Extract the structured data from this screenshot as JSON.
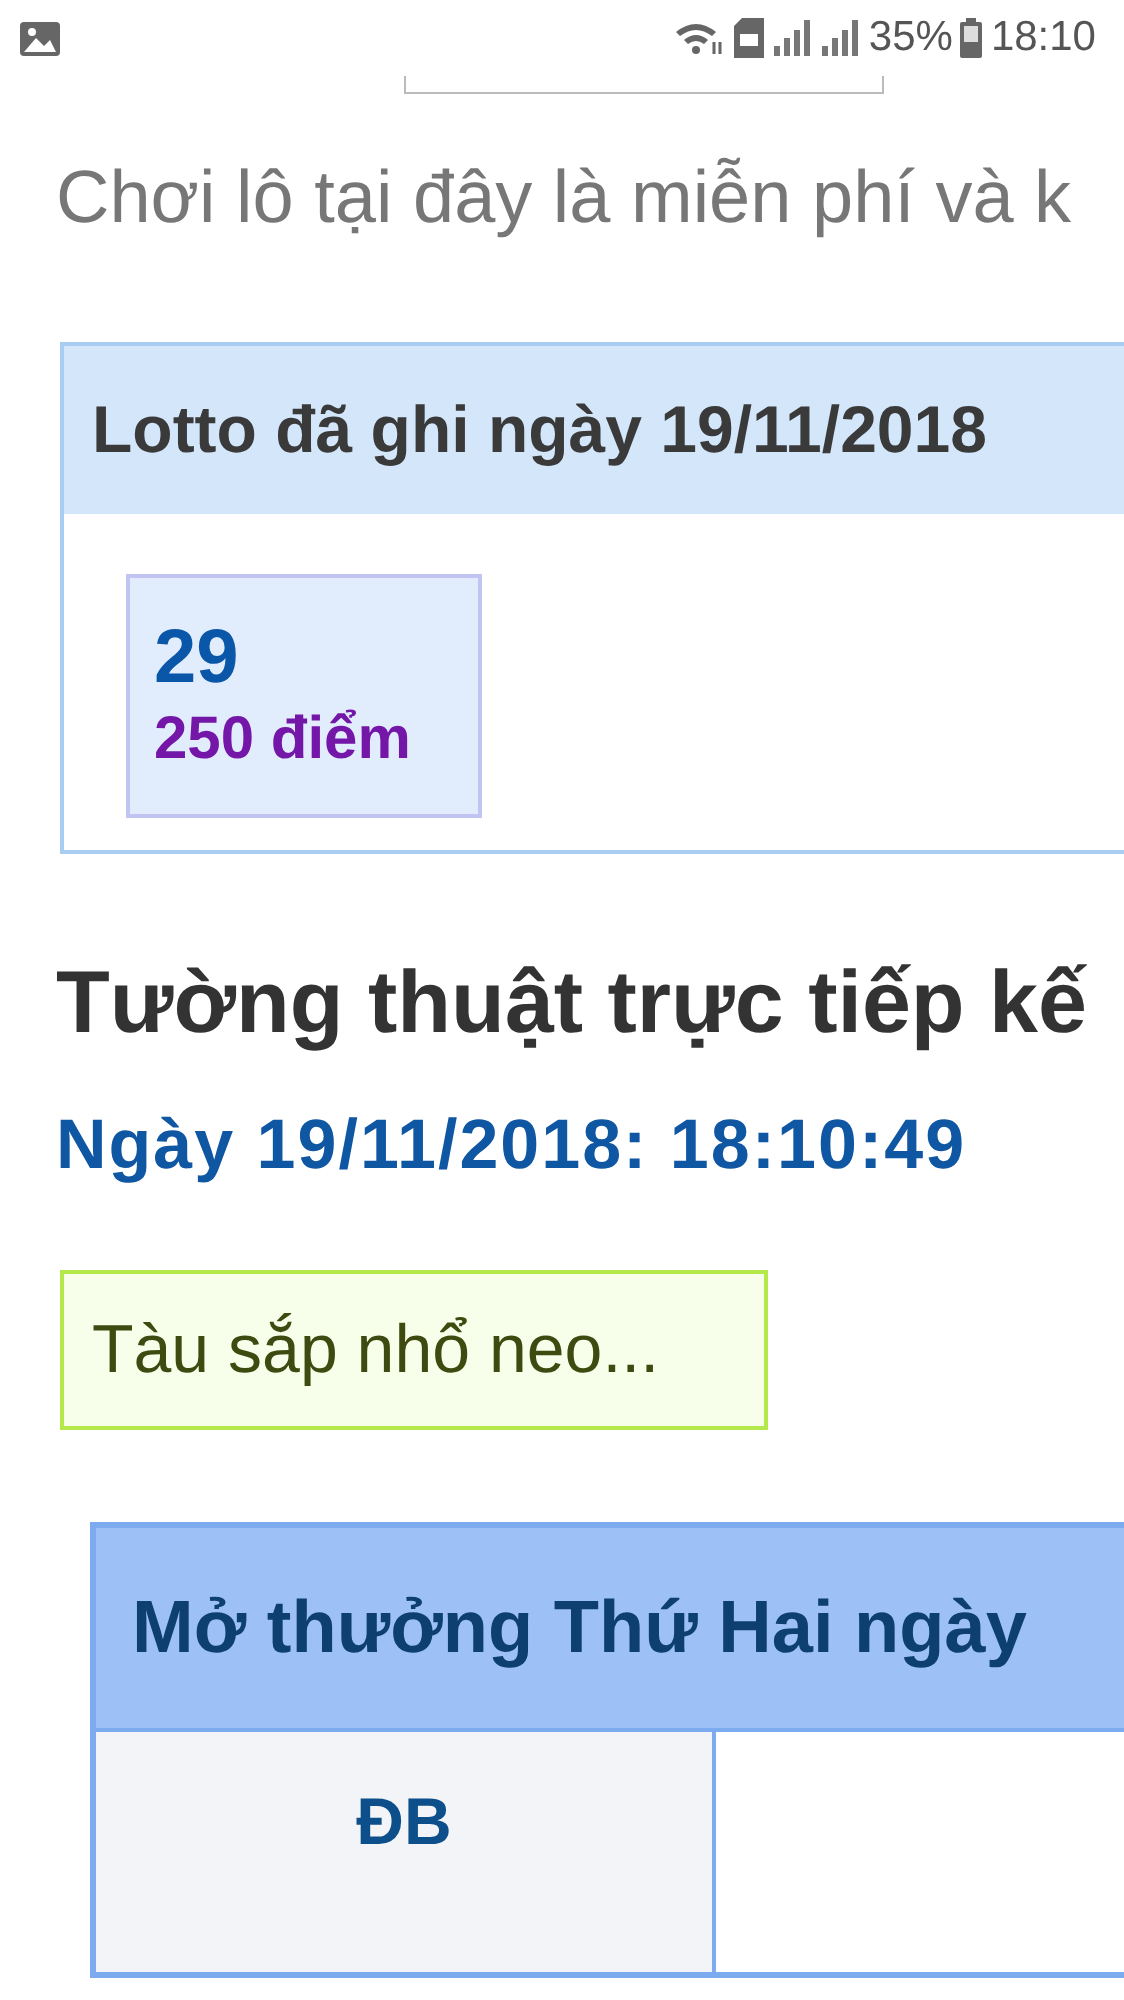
{
  "status_bar": {
    "battery_text": "35%",
    "time": "18:10"
  },
  "intro": "Chơi lô tại đây là miễn phí và k",
  "lotto_panel": {
    "title": "Lotto đã ghi ngày 19/11/2018",
    "items": [
      {
        "number": "29",
        "points": "250 điểm"
      }
    ]
  },
  "live_title": "Tường thuật trực tiếp kế",
  "live_time": "Ngày 19/11/2018: 18:10:49",
  "notice": "Tàu sắp nhổ neo...",
  "results_table": {
    "title": "Mở thưởng Thứ Hai ngày",
    "rows": [
      {
        "prize": "ĐB"
      }
    ]
  }
}
